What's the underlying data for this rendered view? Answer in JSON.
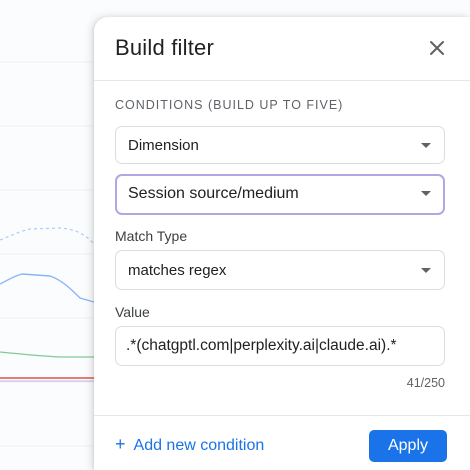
{
  "panel": {
    "title": "Build filter",
    "close_icon": "close-icon",
    "section_label": "CONDITIONS (BUILD UP TO FIVE)",
    "dimension_select": {
      "value": "Dimension"
    },
    "dimension_value_select": {
      "value": "Session source/medium"
    },
    "match_type": {
      "label": "Match Type",
      "value": "matches regex"
    },
    "value_field": {
      "label": "Value",
      "value": ".*(chatgptl.com|perplexity.ai|claude.ai).*",
      "counter": "41/250"
    },
    "footer": {
      "add_condition_icon": "plus-icon",
      "add_condition_label": "Add new condition",
      "apply_label": "Apply"
    }
  },
  "colors": {
    "accent": "#1a73e8",
    "focus_border": "#b5a6e3",
    "chart_blue_solid": "#8ab4f8",
    "chart_blue_dashed": "#aecbfa",
    "chart_green": "#81c995",
    "chart_red": "#d93025"
  }
}
